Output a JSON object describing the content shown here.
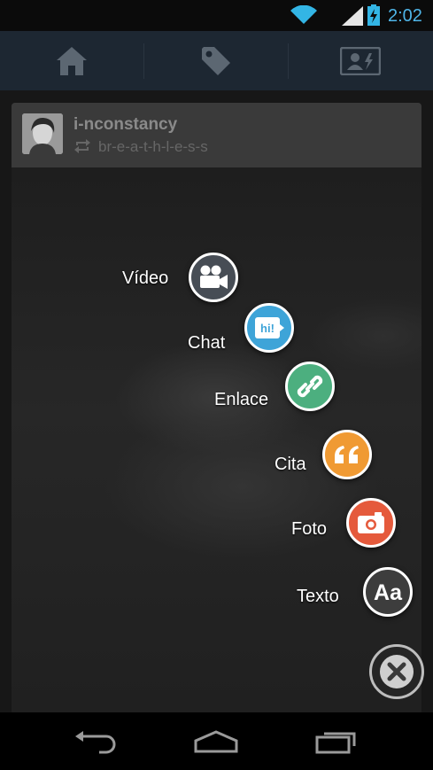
{
  "status_bar": {
    "time": "2:02",
    "icons": [
      "wifi-icon",
      "signal-icon",
      "battery-charging-icon"
    ],
    "accent_color": "#33b5e5"
  },
  "app_bar": {
    "tabs": [
      "home-icon",
      "tag-icon",
      "profile-card-icon"
    ]
  },
  "post": {
    "username": "i-nconstancy",
    "reblogged_from": "br-e-a-t-h-l-e-s-s"
  },
  "compose_menu": {
    "items": [
      {
        "label": "Vídeo",
        "icon": "video-camera-icon",
        "color": "#474d55"
      },
      {
        "label": "Chat",
        "icon": "chat-bubble-icon",
        "color": "#3ea4d8"
      },
      {
        "label": "Enlace",
        "icon": "link-icon",
        "color": "#4caf7f"
      },
      {
        "label": "Cita",
        "icon": "quote-icon",
        "color": "#f09a33"
      },
      {
        "label": "Foto",
        "icon": "camera-icon",
        "color": "#e55a3c"
      },
      {
        "label": "Texto",
        "icon": "text-aa-icon",
        "color": "#3d3d3d"
      }
    ],
    "close_icon": "close-icon"
  },
  "nav_bar": {
    "buttons": [
      "back-icon",
      "home-icon",
      "recent-apps-icon"
    ]
  }
}
